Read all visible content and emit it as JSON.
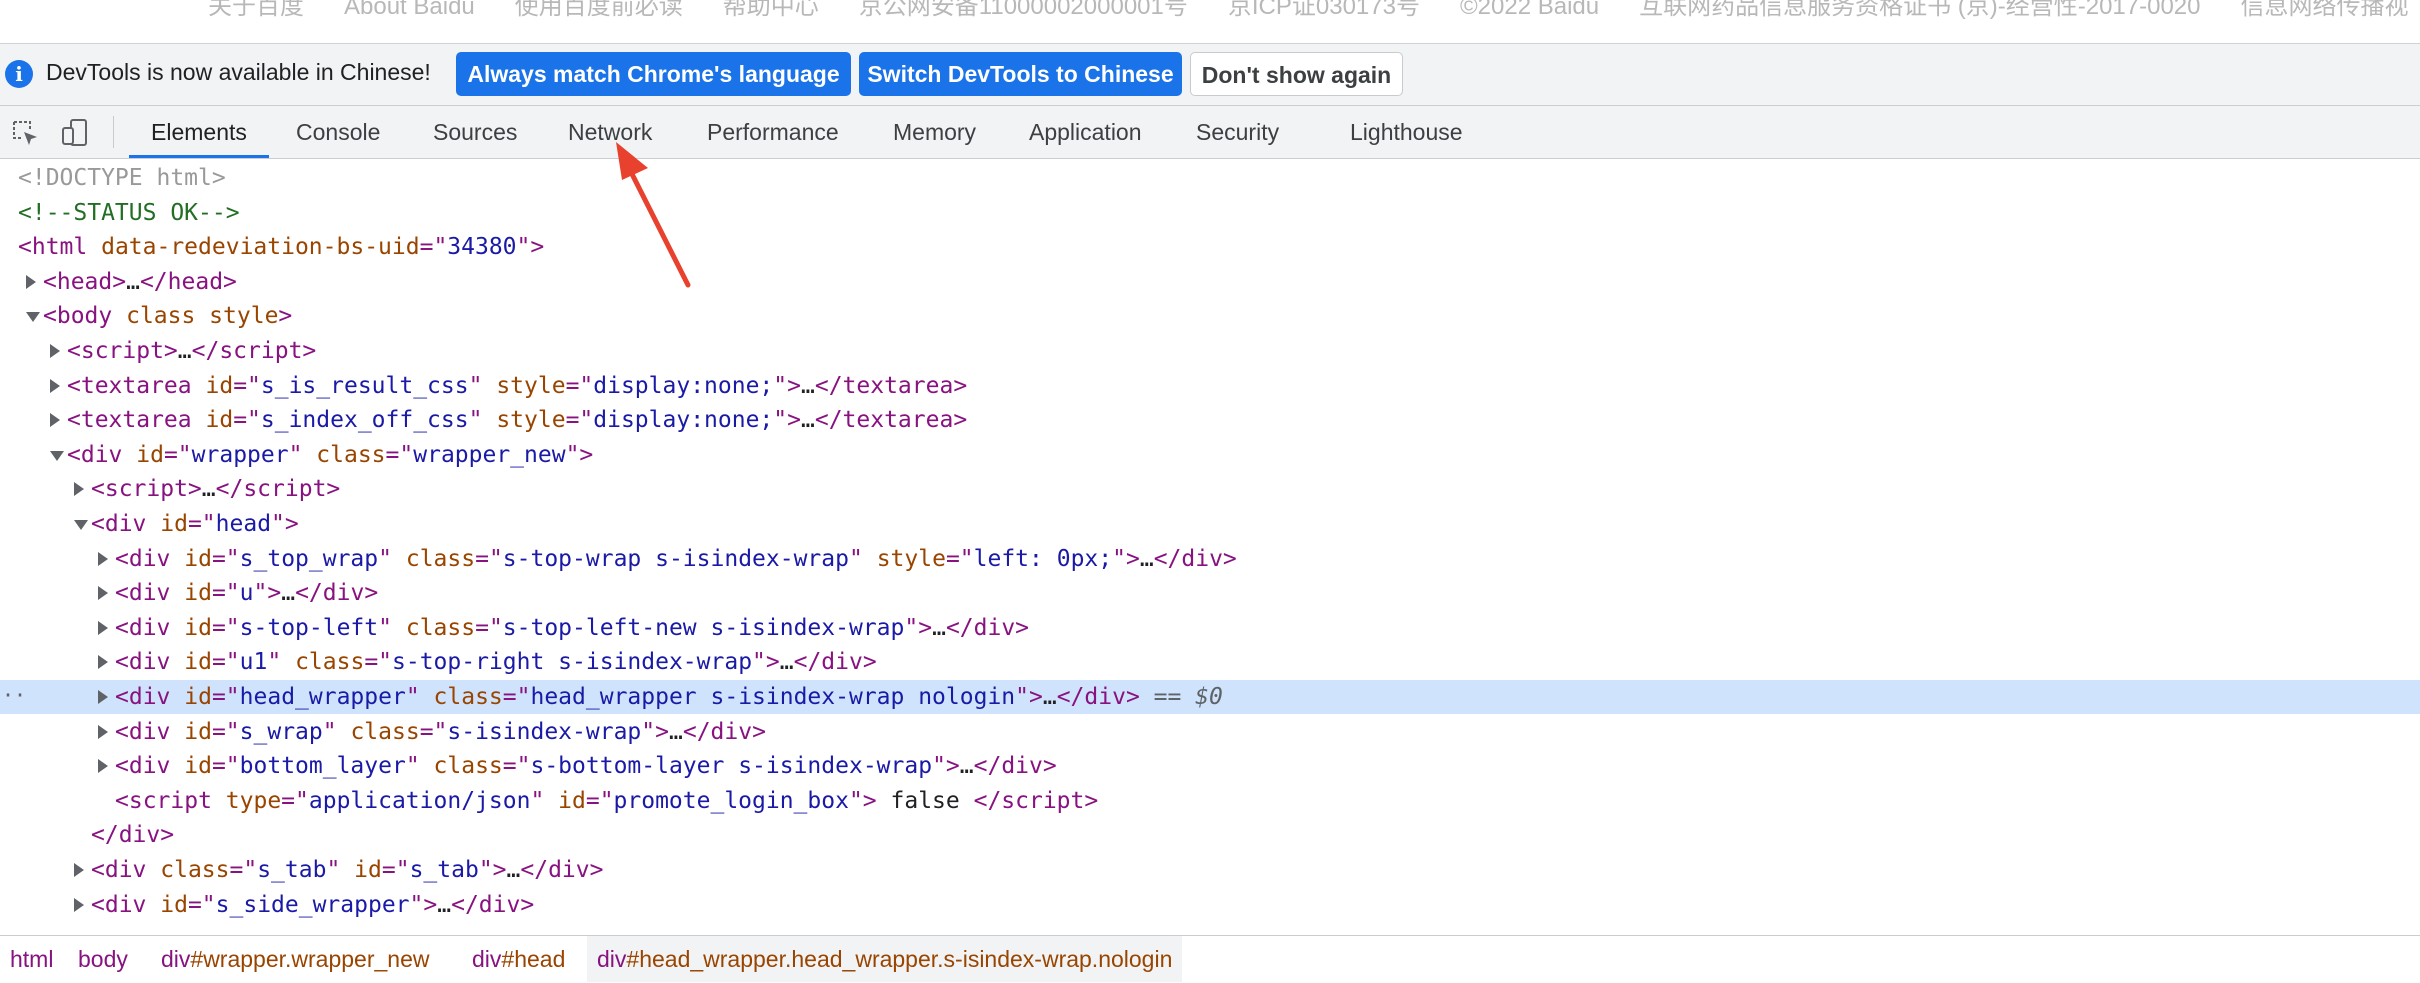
{
  "page_footer": {
    "links": [
      "关于百度",
      "About Baidu",
      "使用百度前必读",
      "帮助中心",
      "京公网安备11000002000001号",
      "京ICP证030173号",
      "©2022 Baidu",
      "互联网药品信息服务资格证书 (京)-经营性-2017-0020",
      "信息网络传播视"
    ]
  },
  "infobar": {
    "message": "DevTools is now available in Chinese!",
    "buttons": {
      "match": "Always match Chrome's language",
      "switch": "Switch DevTools to Chinese",
      "dont_show": "Don't show again"
    }
  },
  "tabs": [
    "Elements",
    "Console",
    "Sources",
    "Network",
    "Performance",
    "Memory",
    "Application",
    "Security",
    "Lighthouse"
  ],
  "active_tab": "Elements",
  "dom_lines": [
    {
      "caret": "none",
      "html": "<span class=\"d\">&lt;!DOCTYPE html&gt;</span>"
    },
    {
      "caret": "none",
      "html": "<span class=\"c\">&lt;!--STATUS OK--&gt;</span>"
    },
    {
      "caret": "none",
      "html": "<span class=\"t\">&lt;html </span><span class=\"a\">data-redeviation-bs-uid</span><span class=\"t\">=\"</span><span class=\"v\">34380</span><span class=\"t\">\"&gt;</span>"
    },
    {
      "caret": "closed",
      "html": "<span class=\"t\">&lt;head&gt;</span><span class=\"p\">…</span><span class=\"t\">&lt;/head&gt;</span>"
    },
    {
      "caret": "open",
      "html": "<span class=\"t\">&lt;body </span><span class=\"a\">class style</span><span class=\"t\">&gt;</span>"
    },
    {
      "caret": "closed",
      "html": "<span class=\"t\">&lt;script&gt;</span><span class=\"p\">…</span><span class=\"t\">&lt;/script&gt;</span>"
    },
    {
      "caret": "closed",
      "html": "<span class=\"t\">&lt;textarea </span><span class=\"a\">id</span><span class=\"t\">=\"</span><span class=\"v\">s_is_result_css</span><span class=\"t\">\" </span><span class=\"a\">style</span><span class=\"t\">=\"</span><span class=\"v\">display:none;</span><span class=\"t\">\"&gt;</span><span class=\"p\">…</span><span class=\"t\">&lt;/textarea&gt;</span>"
    },
    {
      "caret": "closed",
      "html": "<span class=\"t\">&lt;textarea </span><span class=\"a\">id</span><span class=\"t\">=\"</span><span class=\"v\">s_index_off_css</span><span class=\"t\">\" </span><span class=\"a\">style</span><span class=\"t\">=\"</span><span class=\"v\">display:none;</span><span class=\"t\">\"&gt;</span><span class=\"p\">…</span><span class=\"t\">&lt;/textarea&gt;</span>"
    },
    {
      "caret": "open",
      "html": "<span class=\"t\">&lt;div </span><span class=\"a\">id</span><span class=\"t\">=\"</span><span class=\"v\">wrapper</span><span class=\"t\">\" </span><span class=\"a\">class</span><span class=\"t\">=\"</span><span class=\"v\">wrapper_new</span><span class=\"t\">\"&gt;</span>"
    },
    {
      "caret": "closed",
      "html": "<span class=\"t\">&lt;script&gt;</span><span class=\"p\">…</span><span class=\"t\">&lt;/script&gt;</span>"
    },
    {
      "caret": "open",
      "html": "<span class=\"t\">&lt;div </span><span class=\"a\">id</span><span class=\"t\">=\"</span><span class=\"v\">head</span><span class=\"t\">\"&gt;</span>"
    },
    {
      "caret": "closed",
      "html": "<span class=\"t\">&lt;div </span><span class=\"a\">id</span><span class=\"t\">=\"</span><span class=\"v\">s_top_wrap</span><span class=\"t\">\" </span><span class=\"a\">class</span><span class=\"t\">=\"</span><span class=\"v\">s-top-wrap s-isindex-wrap</span><span class=\"t\">\" </span><span class=\"a\">style</span><span class=\"t\">=\"</span><span class=\"v\">left: 0px;</span><span class=\"t\">\"&gt;</span><span class=\"p\">…</span><span class=\"t\">&lt;/div&gt;</span>"
    },
    {
      "caret": "closed",
      "html": "<span class=\"t\">&lt;div </span><span class=\"a\">id</span><span class=\"t\">=\"</span><span class=\"v\">u</span><span class=\"t\">\"&gt;</span><span class=\"p\">…</span><span class=\"t\">&lt;/div&gt;</span>"
    },
    {
      "caret": "closed",
      "html": "<span class=\"t\">&lt;div </span><span class=\"a\">id</span><span class=\"t\">=\"</span><span class=\"v\">s-top-left</span><span class=\"t\">\" </span><span class=\"a\">class</span><span class=\"t\">=\"</span><span class=\"v\">s-top-left-new s-isindex-wrap</span><span class=\"t\">\"&gt;</span><span class=\"p\">…</span><span class=\"t\">&lt;/div&gt;</span>"
    },
    {
      "caret": "closed",
      "html": "<span class=\"t\">&lt;div </span><span class=\"a\">id</span><span class=\"t\">=\"</span><span class=\"v\">u1</span><span class=\"t\">\" </span><span class=\"a\">class</span><span class=\"t\">=\"</span><span class=\"v\">s-top-right s-isindex-wrap</span><span class=\"t\">\"&gt;</span><span class=\"p\">…</span><span class=\"t\">&lt;/div&gt;</span>"
    },
    {
      "caret": "closed",
      "selected": true,
      "html": "<span class=\"t\">&lt;div </span><span class=\"a\">id</span><span class=\"t\">=\"</span><span class=\"v\">head_wrapper</span><span class=\"t\">\" </span><span class=\"a\">class</span><span class=\"t\">=\"</span><span class=\"v\">head_wrapper s-isindex-wrap nologin</span><span class=\"t\">\"&gt;</span><span class=\"p\">…</span><span class=\"t\">&lt;/div&gt;</span><span class=\"sel-ind\"> == $0</span>"
    },
    {
      "caret": "closed",
      "html": "<span class=\"t\">&lt;div </span><span class=\"a\">id</span><span class=\"t\">=\"</span><span class=\"v\">s_wrap</span><span class=\"t\">\" </span><span class=\"a\">class</span><span class=\"t\">=\"</span><span class=\"v\">s-isindex-wrap</span><span class=\"t\">\"&gt;</span><span class=\"p\">…</span><span class=\"t\">&lt;/div&gt;</span>"
    },
    {
      "caret": "closed",
      "html": "<span class=\"t\">&lt;div </span><span class=\"a\">id</span><span class=\"t\">=\"</span><span class=\"v\">bottom_layer</span><span class=\"t\">\" </span><span class=\"a\">class</span><span class=\"t\">=\"</span><span class=\"v\">s-bottom-layer s-isindex-wrap</span><span class=\"t\">\"&gt;</span><span class=\"p\">…</span><span class=\"t\">&lt;/div&gt;</span>"
    },
    {
      "caret": "none",
      "html": "<span class=\"t\">&lt;script </span><span class=\"a\">type</span><span class=\"t\">=\"</span><span class=\"v\">application/json</span><span class=\"t\">\" </span><span class=\"a\">id</span><span class=\"t\">=\"</span><span class=\"v\">promote_login_box</span><span class=\"t\">\"&gt;</span><span class=\"p\"> false </span><span class=\"t\">&lt;/script&gt;</span>"
    },
    {
      "caret": "none",
      "html": "<span class=\"t\">&lt;/div&gt;</span>"
    },
    {
      "caret": "closed",
      "html": "<span class=\"t\">&lt;div </span><span class=\"a\">class</span><span class=\"t\">=\"</span><span class=\"v\">s_tab</span><span class=\"t\">\" </span><span class=\"a\">id</span><span class=\"t\">=\"</span><span class=\"v\">s_tab</span><span class=\"t\">\"&gt;</span><span class=\"p\">…</span><span class=\"t\">&lt;/div&gt;</span>"
    },
    {
      "caret": "closed",
      "html": "<span class=\"t\">&lt;div </span><span class=\"a\">id</span><span class=\"t\">=\"</span><span class=\"v\">s_side_wrapper</span><span class=\"t\">\"&gt;</span><span class=\"p\">…</span><span class=\"t\">&lt;/div&gt;</span>"
    }
  ],
  "breadcrumb": [
    {
      "tag": "html",
      "ident": ""
    },
    {
      "tag": "body",
      "ident": ""
    },
    {
      "tag": "div",
      "ident": "#wrapper.wrapper_new"
    },
    {
      "tag": "div",
      "ident": "#head"
    },
    {
      "tag": "div",
      "ident": "#head_wrapper.head_wrapper.s-isindex-wrap.nologin"
    }
  ],
  "colors": {
    "accent": "#1a73e8",
    "selected_row": "#cfe3fc",
    "annotation_arrow": "#e8412e",
    "tag": "#881280",
    "attr_name": "#994500",
    "attr_value": "#1a1aa6"
  }
}
